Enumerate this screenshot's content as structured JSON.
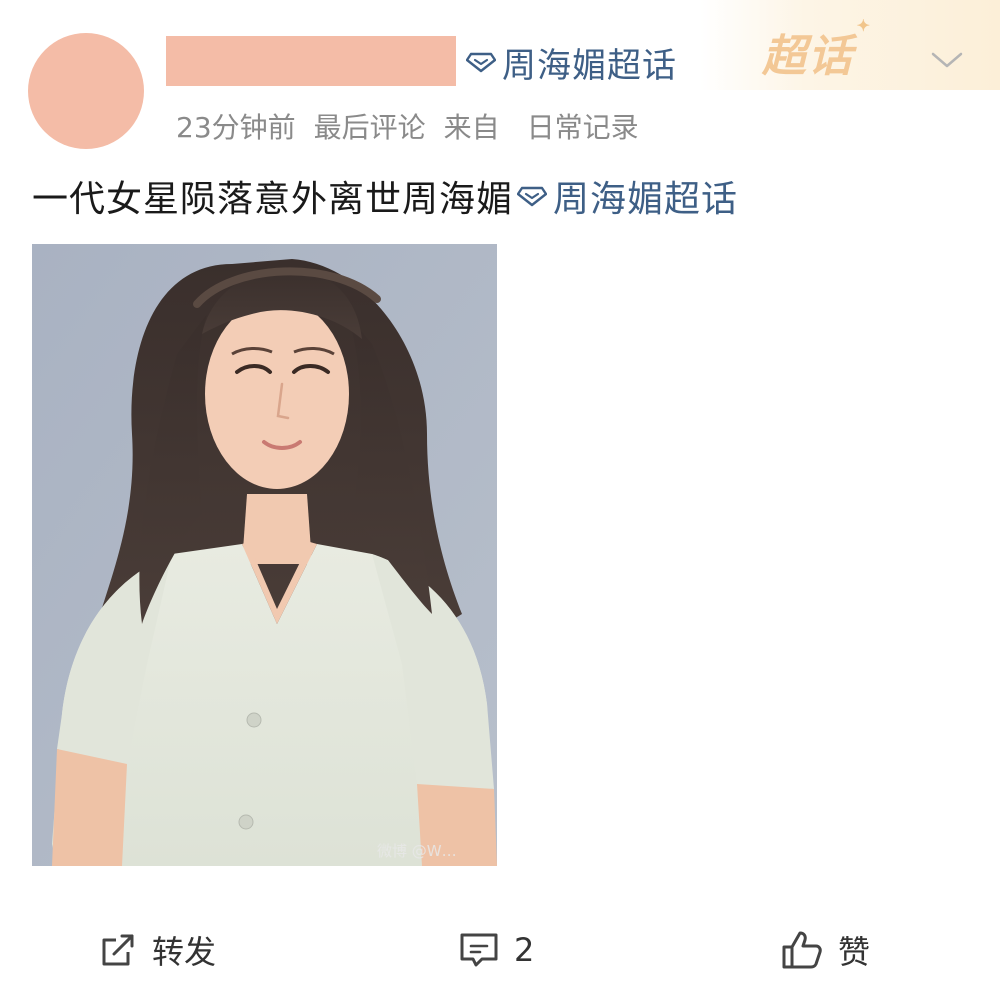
{
  "post": {
    "author": {
      "name_redacted": true,
      "topic_label": "周海媚超话"
    },
    "badge": "超话",
    "meta": {
      "time": "23分钟前",
      "sort": "最后评论",
      "source_prefix": "来自",
      "source": "日常记录"
    },
    "text": "一代女星陨落意外离世周海媚",
    "text_topic": "周海媚超话",
    "image": {
      "watermark": "微博 @W…"
    }
  },
  "actions": {
    "repost_label": "转发",
    "comment_count": "2",
    "like_label": "赞"
  },
  "icons": {
    "topic": "diamond-topic-icon",
    "menu": "chevron-down-icon",
    "repost": "repost-icon",
    "comment": "comment-icon",
    "like": "thumbs-up-icon"
  },
  "colors": {
    "topic_link": "#3e5f86",
    "meta_text": "#8a8a8a",
    "badge": "#f3c896",
    "redaction": "#f4bca7"
  }
}
